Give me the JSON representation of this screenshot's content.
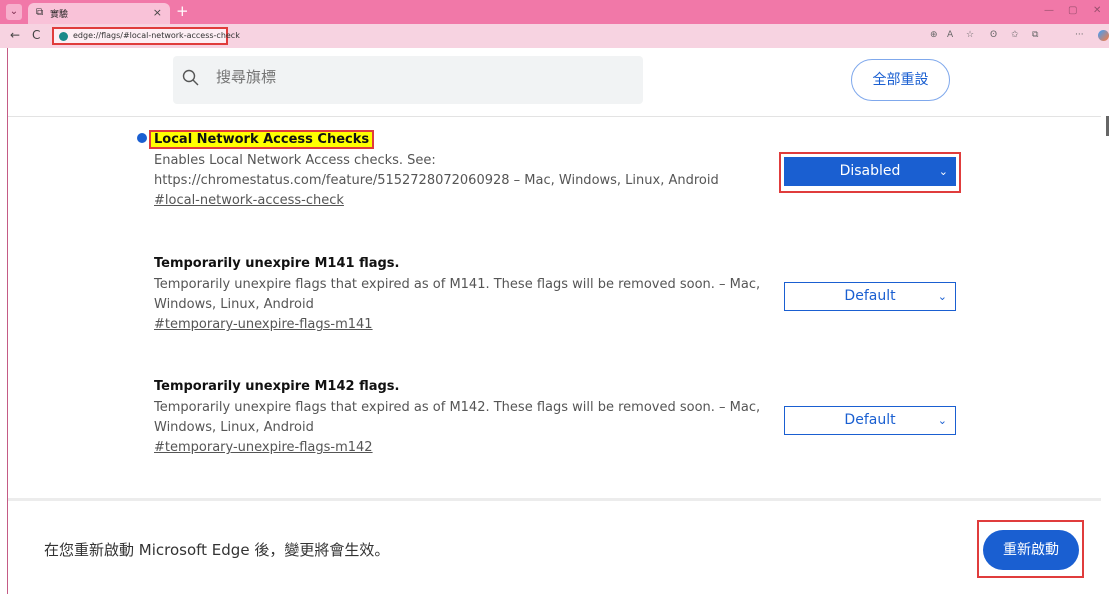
{
  "window": {
    "tab_title": "實驗",
    "tab_icon": "⧉",
    "tab_close": "×",
    "new_tab": "+",
    "tab_toggle": "⌄",
    "minimize": "—",
    "maximize": "▢",
    "close": "✕"
  },
  "addressbar": {
    "back": "←",
    "reload": "C",
    "url": "edge://flags/#local-network-access-check",
    "zoom_icon": "⊕",
    "read_aloud_icon": "A",
    "favorite_icon": "☆",
    "extensions_icon": "ʘ",
    "favorites_icon": "✩",
    "collections_icon": "⧉",
    "more_icon": "···"
  },
  "search": {
    "placeholder": "搜尋旗標"
  },
  "reset_all_label": "全部重設",
  "flags": [
    {
      "title": "Local Network Access Checks",
      "description": "Enables Local Network Access checks. See: https://chromestatus.com/feature/5152728072060928 – Mac, Windows, Linux, Android",
      "link": "#local-network-access-check",
      "value": "Disabled"
    },
    {
      "title": "Temporarily unexpire M141 flags.",
      "description": "Temporarily unexpire flags that expired as of M141. These flags will be removed soon. – Mac, Windows, Linux, Android",
      "link": "#temporary-unexpire-flags-m141",
      "value": "Default"
    },
    {
      "title": "Temporarily unexpire M142 flags.",
      "description": "Temporarily unexpire flags that expired as of M142. These flags will be removed soon. – Mac, Windows, Linux, Android",
      "link": "#temporary-unexpire-flags-m142",
      "value": "Default"
    }
  ],
  "footer": {
    "message": "在您重新啟動 Microsoft Edge 後，變更將會生效。",
    "relaunch_label": "重新啟動"
  },
  "colors": {
    "titlebar": "#f178a8",
    "accent": "#1a5fd1",
    "annotation": "#e03c3c",
    "highlight": "#ffff00"
  }
}
